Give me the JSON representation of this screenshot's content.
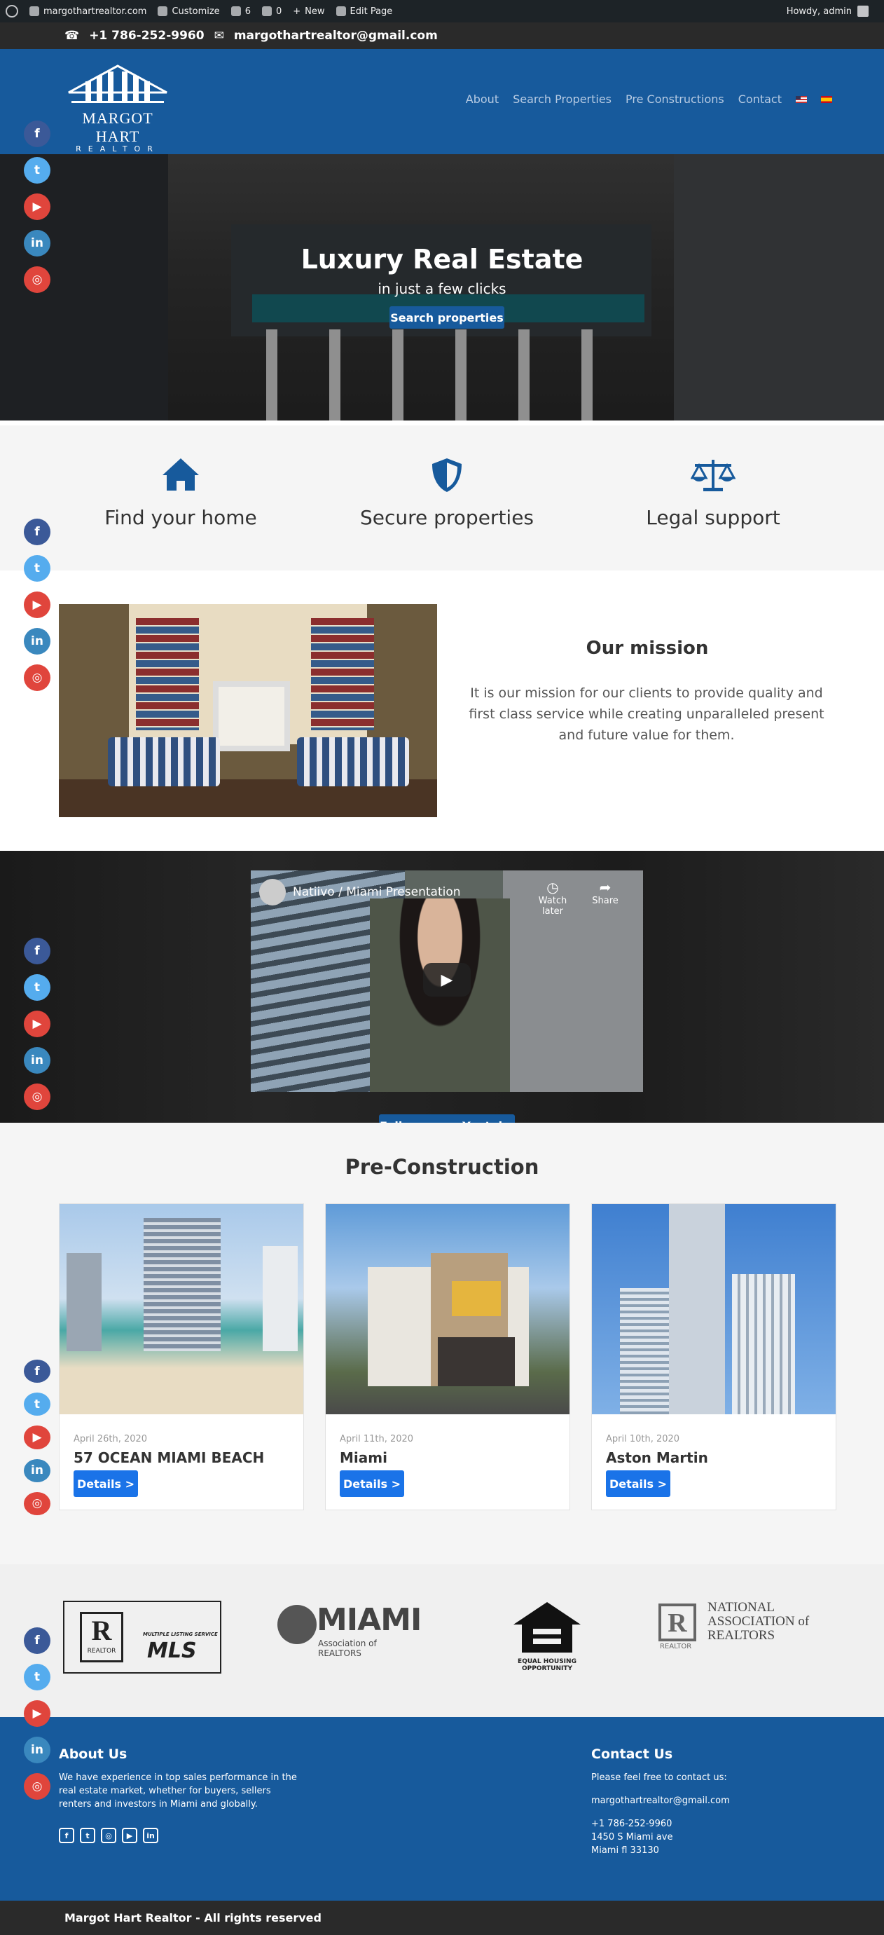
{
  "adminbar": {
    "site": "margothartrealtor.com",
    "customize": "Customize",
    "updates": "6",
    "comments": "0",
    "new": "New",
    "edit": "Edit Page",
    "howdy": "Howdy, admin"
  },
  "topbar": {
    "phone": "+1 786-252-9960",
    "email": "margothartrealtor@gmail.com"
  },
  "logo": {
    "name": "MARGOT HART",
    "sub": "REALTOR"
  },
  "nav": {
    "items": [
      "About",
      "Search Properties",
      "Pre Constructions",
      "Contact"
    ],
    "flags": [
      "en-flag",
      "es-flag"
    ]
  },
  "hero": {
    "title": "Luxury Real Estate",
    "tagline": "in just a few clicks",
    "button": "Search properties"
  },
  "features": [
    {
      "label": "Find your home",
      "icon": "home-icon"
    },
    {
      "label": "Secure properties",
      "icon": "shield-icon"
    },
    {
      "label": "Legal support",
      "icon": "balance-scale-icon"
    }
  ],
  "mission": {
    "title": "Our mission",
    "text": "It is our mission for our clients to provide quality and first class service while creating unparalleled present and future value for them."
  },
  "video": {
    "title": "Natiivo / Miami Presentation",
    "watch_later": "Watch later",
    "share": "Share",
    "follow": "Follow us on Youtube"
  },
  "precon": {
    "title": "Pre-Construction",
    "cards": [
      {
        "date": "April 26th, 2020",
        "name": "57 OCEAN MIAMI BEACH",
        "button": "Details >"
      },
      {
        "date": "April 11th, 2020",
        "name": "Miami",
        "button": "Details >"
      },
      {
        "date": "April 10th, 2020",
        "name": "Aston Martin",
        "button": "Details >"
      }
    ]
  },
  "partners": {
    "mls": {
      "realtor": "REALTOR",
      "service": "MULTIPLE LISTING SERVICE",
      "mls": "MLS"
    },
    "miami": {
      "name": "MIAMI",
      "sub": "Association of REALTORS"
    },
    "equal": {
      "line1": "EQUAL HOUSING",
      "line2": "OPPORTUNITY"
    },
    "nar": {
      "line1": "NATIONAL",
      "line2": "ASSOCIATION of",
      "line3": "REALTORS",
      "realtor": "REALTOR"
    }
  },
  "footer": {
    "about_title": "About Us",
    "about_text": "We have experience in top sales performance in the real estate market, whether for buyers, sellers renters and investors in Miami and globally.",
    "contact_title": "Contact Us",
    "contact_intro": "Please feel free to contact us:",
    "email": "margothartrealtor@gmail.com",
    "phone": "+1 786-252-9960",
    "address1": "1450 S Miami ave",
    "address2": "Miami fl 33130"
  },
  "copyright": "Margot Hart Realtor - All rights reserved",
  "colors": {
    "brand": "#175a9c",
    "button_blue": "#1a73e8",
    "dark": "#2a2a2a"
  }
}
